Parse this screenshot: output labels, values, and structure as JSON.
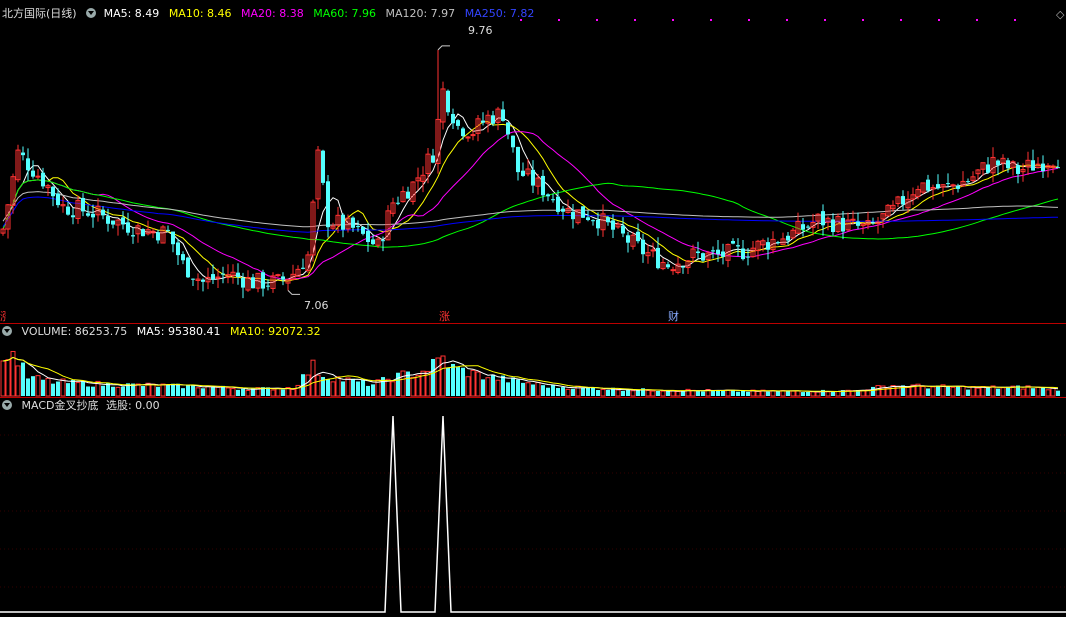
{
  "title": "北方国际(日线)",
  "colors": {
    "up": "#ff3232",
    "down": "#54ffff",
    "ma5": "#ffffff",
    "ma10": "#ffff00",
    "ma20": "#ff00ff",
    "ma60": "#00ff00",
    "ma120": "#c0c0c0",
    "ma250": "#0000ff"
  },
  "price_header": {
    "ma5": "MA5: 8.49",
    "ma10": "MA10: 8.46",
    "ma20": "MA20: 8.38",
    "ma60": "MA60: 7.96",
    "ma120": "MA120: 7.97",
    "ma250": "MA250: 7.82"
  },
  "volume_header": {
    "name": "VOLUME: 86253.75",
    "ma5": "MA5: 95380.41",
    "ma10": "MA10: 92072.32"
  },
  "macd_header": {
    "name": "MACD金叉抄底",
    "value": "选股: 0.00"
  },
  "markers": {
    "high": "9.76",
    "low": "7.06",
    "zhang": "涨",
    "cai": "财",
    "left_edge": "涨"
  },
  "chart_data": {
    "type": "candlestick",
    "y_range": [
      6.75,
      10.05
    ],
    "high_label": {
      "index": 87,
      "value": 9.76
    },
    "low_label": {
      "index": 57,
      "value": 7.06
    },
    "close_waypoints": [
      [
        0,
        7.75
      ],
      [
        3,
        8.6
      ],
      [
        8,
        8.3
      ],
      [
        12,
        8.0
      ],
      [
        17,
        7.95
      ],
      [
        22,
        7.85
      ],
      [
        27,
        7.75
      ],
      [
        33,
        7.7
      ],
      [
        36,
        7.35
      ],
      [
        40,
        7.15
      ],
      [
        45,
        7.25
      ],
      [
        50,
        7.15
      ],
      [
        55,
        7.15
      ],
      [
        58,
        7.25
      ],
      [
        61,
        7.45
      ],
      [
        63,
        8.55
      ],
      [
        65,
        7.85
      ],
      [
        70,
        7.75
      ],
      [
        75,
        7.55
      ],
      [
        78,
        8.05
      ],
      [
        82,
        8.25
      ],
      [
        86,
        8.6
      ],
      [
        88,
        9.3
      ],
      [
        91,
        8.9
      ],
      [
        94,
        8.85
      ],
      [
        97,
        9.0
      ],
      [
        100,
        9.05
      ],
      [
        103,
        8.4
      ],
      [
        108,
        8.2
      ],
      [
        113,
        7.95
      ],
      [
        118,
        7.9
      ],
      [
        123,
        7.7
      ],
      [
        128,
        7.5
      ],
      [
        133,
        7.35
      ],
      [
        138,
        7.45
      ],
      [
        143,
        7.45
      ],
      [
        148,
        7.5
      ],
      [
        153,
        7.6
      ],
      [
        158,
        7.7
      ],
      [
        163,
        7.85
      ],
      [
        168,
        7.8
      ],
      [
        173,
        7.75
      ],
      [
        178,
        7.95
      ],
      [
        183,
        8.25
      ],
      [
        188,
        8.2
      ],
      [
        193,
        8.3
      ],
      [
        198,
        8.5
      ],
      [
        203,
        8.4
      ],
      [
        210,
        8.55
      ]
    ],
    "volume_waypoints": [
      [
        0,
        2.5
      ],
      [
        1,
        4.0
      ],
      [
        3,
        3.0
      ],
      [
        5,
        1.6
      ],
      [
        10,
        1.2
      ],
      [
        20,
        1.0
      ],
      [
        30,
        0.9
      ],
      [
        40,
        0.8
      ],
      [
        50,
        0.6
      ],
      [
        58,
        0.7
      ],
      [
        62,
        2.5
      ],
      [
        64,
        1.8
      ],
      [
        68,
        1.4
      ],
      [
        74,
        1.0
      ],
      [
        78,
        1.6
      ],
      [
        84,
        2.1
      ],
      [
        88,
        3.2
      ],
      [
        90,
        2.4
      ],
      [
        95,
        1.8
      ],
      [
        102,
        1.3
      ],
      [
        110,
        0.8
      ],
      [
        125,
        0.55
      ],
      [
        150,
        0.4
      ],
      [
        170,
        0.45
      ],
      [
        178,
        0.9
      ],
      [
        185,
        0.8
      ],
      [
        195,
        0.7
      ],
      [
        205,
        0.75
      ],
      [
        210,
        0.6
      ]
    ],
    "macd_spikes": [
      78,
      88
    ]
  }
}
